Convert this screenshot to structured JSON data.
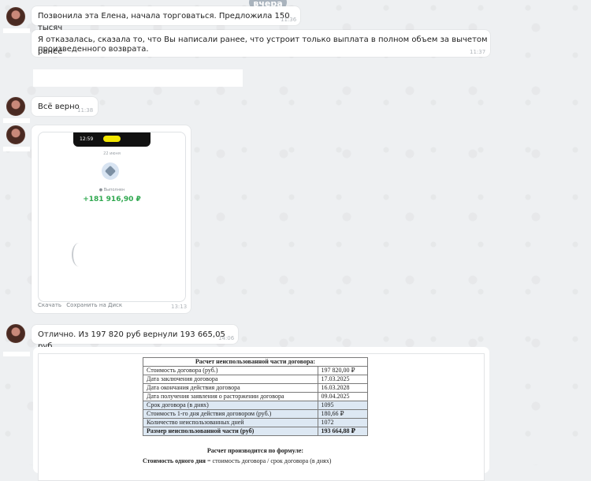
{
  "date_pill": "вчера",
  "messages": [
    {
      "text": "Позвонила эта Елена, начала торговаться. Предложила 150 тысяч",
      "time": "11:36"
    },
    {
      "text_line1": "Я отказалась, сказала то, что Вы написали ранее, что устроит только выплата в полном объем за вычетом ранее",
      "text_line2": "произведенного возврата.",
      "time": "11:37"
    },
    {
      "text": "Всё верно",
      "time": "11:38"
    },
    {
      "text": "Отлично. Из 197 820 руб вернули 193 665,05 руб",
      "time": "14:06"
    }
  ],
  "phone_screenshot": {
    "status_time": "12:59",
    "date_line": "22 июня",
    "status_label": "● Выполнен",
    "amount": "+181 916,90 ₽",
    "time": "13:13"
  },
  "attachment_actions": {
    "download": "Скачать",
    "save_disk": "Сохранить на Диск"
  },
  "document": {
    "title": "Расчет неиспользованной части договора:",
    "rows": [
      {
        "label": "Стоимость договора (руб.)",
        "value": "197 820,00 ₽"
      },
      {
        "label": "Дата заключения договора",
        "value": "17.03.2025"
      },
      {
        "label": "Дата окончания действия договора",
        "value": "16.03.2028"
      },
      {
        "label": "Дата получения заявления о расторжении договора",
        "value": "09.04.2025"
      },
      {
        "label": "Срок договора (в днях)",
        "value": "1095"
      },
      {
        "label": "Стоимость 1-го дня действия договором (руб.)",
        "value": "180,66 ₽"
      },
      {
        "label": "Количество неиспользованных дней",
        "value": "1072"
      },
      {
        "label": "Размер неиспользованной части (руб)",
        "value": "193 664,88 ₽"
      }
    ],
    "formula_title": "Расчет производится по формуле:",
    "formula_bold": "Стоимость одного дня",
    "formula_rest": " = стоимость договора / срок договора (в днях)"
  },
  "colors": {
    "amount_green": "#2fa84f",
    "table_highlight": "#dde8f3",
    "background": "#eef0f2"
  }
}
